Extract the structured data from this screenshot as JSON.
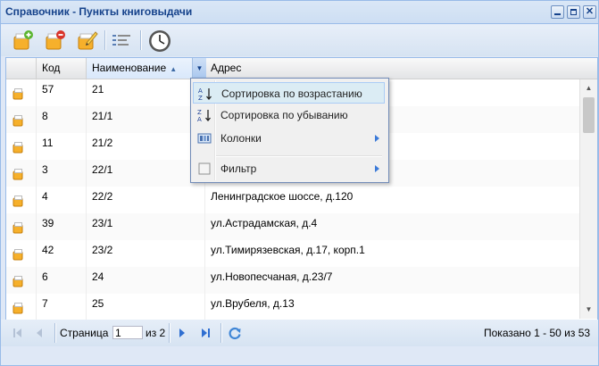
{
  "window": {
    "title": "Справочник - Пункты книговыдачи"
  },
  "toolbar": {
    "buttons": [
      {
        "name": "add-icon"
      },
      {
        "name": "delete-icon"
      },
      {
        "name": "edit-icon"
      },
      {
        "name": "list-icon"
      },
      {
        "name": "clock-icon"
      }
    ]
  },
  "grid": {
    "columns": [
      {
        "label": ""
      },
      {
        "label": "Код"
      },
      {
        "label": "Наименование"
      },
      {
        "label": "Адрес"
      }
    ],
    "sorted_column": "Наименование",
    "rows": [
      {
        "code": "57",
        "name": "21",
        "address": ""
      },
      {
        "code": "8",
        "name": "21/1",
        "address": ""
      },
      {
        "code": "11",
        "name": "21/2",
        "address": ""
      },
      {
        "code": "3",
        "name": "22/1",
        "address": ""
      },
      {
        "code": "4",
        "name": "22/2",
        "address": "Ленинградское шоссе, д.120"
      },
      {
        "code": "39",
        "name": "23/1",
        "address": "ул.Астрадамская, д.4"
      },
      {
        "code": "42",
        "name": "23/2",
        "address": "ул.Тимирязевская, д.17, корп.1"
      },
      {
        "code": "6",
        "name": "24",
        "address": "ул.Новопесчаная, д.23/7"
      },
      {
        "code": "7",
        "name": "25",
        "address": "ул.Врубеля, д.13"
      }
    ]
  },
  "column_menu": {
    "items": [
      {
        "label": "Сортировка по возрастанию",
        "icon": "sort-ascending-icon",
        "active": true,
        "submenu": false
      },
      {
        "label": "Сортировка по убыванию",
        "icon": "sort-descending-icon",
        "active": false,
        "submenu": false
      },
      {
        "label": "Колонки",
        "icon": "columns-icon",
        "active": false,
        "submenu": true
      },
      {
        "label": "Фильтр",
        "icon": "filter-checkbox-icon",
        "active": false,
        "submenu": true
      }
    ]
  },
  "pager": {
    "page_label": "Страница",
    "page_value": "1",
    "of_label": "из 2",
    "summary": "Показано 1 - 50 из 53"
  },
  "colors": {
    "accent": "#15428b",
    "border": "#99bbe8",
    "menu_active": "#dbecf4"
  }
}
